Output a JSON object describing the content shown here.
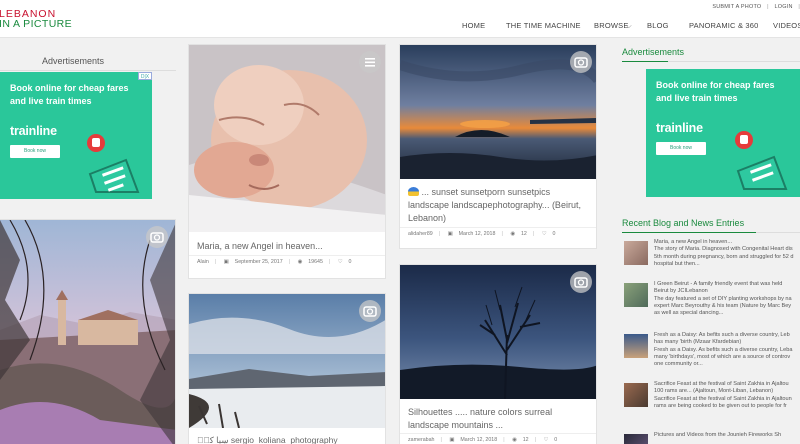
{
  "site": {
    "logo_line1": "LEBANON",
    "logo_line2": "IN A PICTURE"
  },
  "top_links": {
    "submit": "SUBMIT A PHOTO",
    "login": "LOGIN"
  },
  "nav": {
    "items": [
      "HOME",
      "THE TIME MACHINE",
      "BROWSE",
      "BLOG",
      "PANORAMIC & 360",
      "VIDEOS"
    ]
  },
  "ads": {
    "left_title": "Advertisements",
    "right_title": "Advertisements",
    "ad_text": "Book online for cheap fares and live train times",
    "brand": "trainline",
    "button": "Book now"
  },
  "cards": [
    {
      "title": "Maria, a new Angel in heaven...",
      "author": "Alain",
      "date": "September 25, 2017",
      "views": "19645",
      "likes": "0"
    },
    {
      "title": "... sunset sunsetporn sunsetpics landscape landscapephotography... (Beirut, Lebanon)",
      "author": "alidaher89",
      "date": "March 12, 2018",
      "views": "12",
      "likes": "0"
    },
    {
      "title": "sergio_koliana_photography",
      "author": "",
      "date": "",
      "views": "",
      "likes": ""
    },
    {
      "title": "Silhouettes ..... nature colors surreal landscape mountains ...",
      "author": "zamerabah",
      "date": "March 12, 2018",
      "views": "12",
      "likes": "0"
    }
  ],
  "card_extra": {
    "arabic_prefix": "سِبا کہٗ"
  },
  "sidebar": {
    "blog_heading": "Recent Blog and News Entries",
    "entries": [
      {
        "lines": [
          "Maria, a new Angel in heaven...",
          "The story of Maria. Diagnosed with Congenital Heart dis",
          "5th month during pregnancy, born and struggled for 52 d",
          "hospital but then..."
        ]
      },
      {
        "lines": [
          "I Green Beirut - A family friendly event that was held",
          "Beirut by JCILebanon",
          "The day featured a set of DIY planting workshops by na",
          "expert Marc Beyrouthy & his team (Nature by Marc Bey",
          "as well as special dancing..."
        ]
      },
      {
        "lines": [
          "Fresh as a Daisy: As befits such a diverse country, Leb",
          "has many 'birth (Mzaar Kfardebian)",
          "Fresh as a Daisy. As befits such a diverse country, Leba",
          "many 'birthdays', most of which are a source of controv",
          "one community or..."
        ]
      },
      {
        "lines": [
          "Sacrifice Feast at the festival of Saint Zakhia in Ajaltou",
          "100 rams are... (Ajaltoun, Mont-Liban, Lebanon)",
          "Sacrifice Feast at the festival of Saint Zakhia in Ajaltoun",
          "rams are being cooked to be given out to people for fr"
        ]
      },
      {
        "lines": [
          "Pictures and Videos from the Jounieh Fireworks Sh"
        ]
      }
    ]
  },
  "colors": {
    "brand_red": "#c8102e",
    "brand_green": "#1a8a3e",
    "ad_green": "#2ac79a"
  }
}
